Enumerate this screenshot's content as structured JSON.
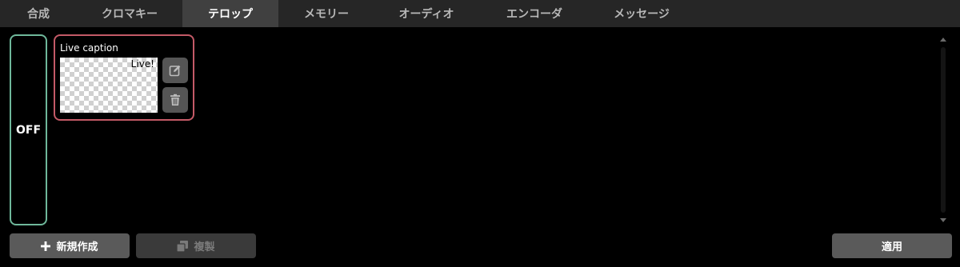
{
  "tabs": [
    {
      "label": "合成",
      "active": false
    },
    {
      "label": "クロマキー",
      "active": false
    },
    {
      "label": "テロップ",
      "active": true
    },
    {
      "label": "メモリー",
      "active": false
    },
    {
      "label": "オーディオ",
      "active": false
    },
    {
      "label": "エンコーダ",
      "active": false
    },
    {
      "label": "メッセージ",
      "active": false
    }
  ],
  "toggle": {
    "label": "OFF",
    "state": "off"
  },
  "captions": [
    {
      "title": "Live caption",
      "preview_text": "Live!",
      "actions": [
        "edit-icon",
        "trash-icon"
      ]
    }
  ],
  "buttons": {
    "new_label": "新規作成",
    "duplicate_label": "複製",
    "apply_label": "適用"
  },
  "colors": {
    "background": "#000000",
    "tab_bar": "#262626",
    "tab_active": "#404040",
    "toggle_border": "#6fb89b",
    "card_border": "#c45a67",
    "button": "#5a5a5a",
    "button_disabled": "#3a3a3a"
  }
}
